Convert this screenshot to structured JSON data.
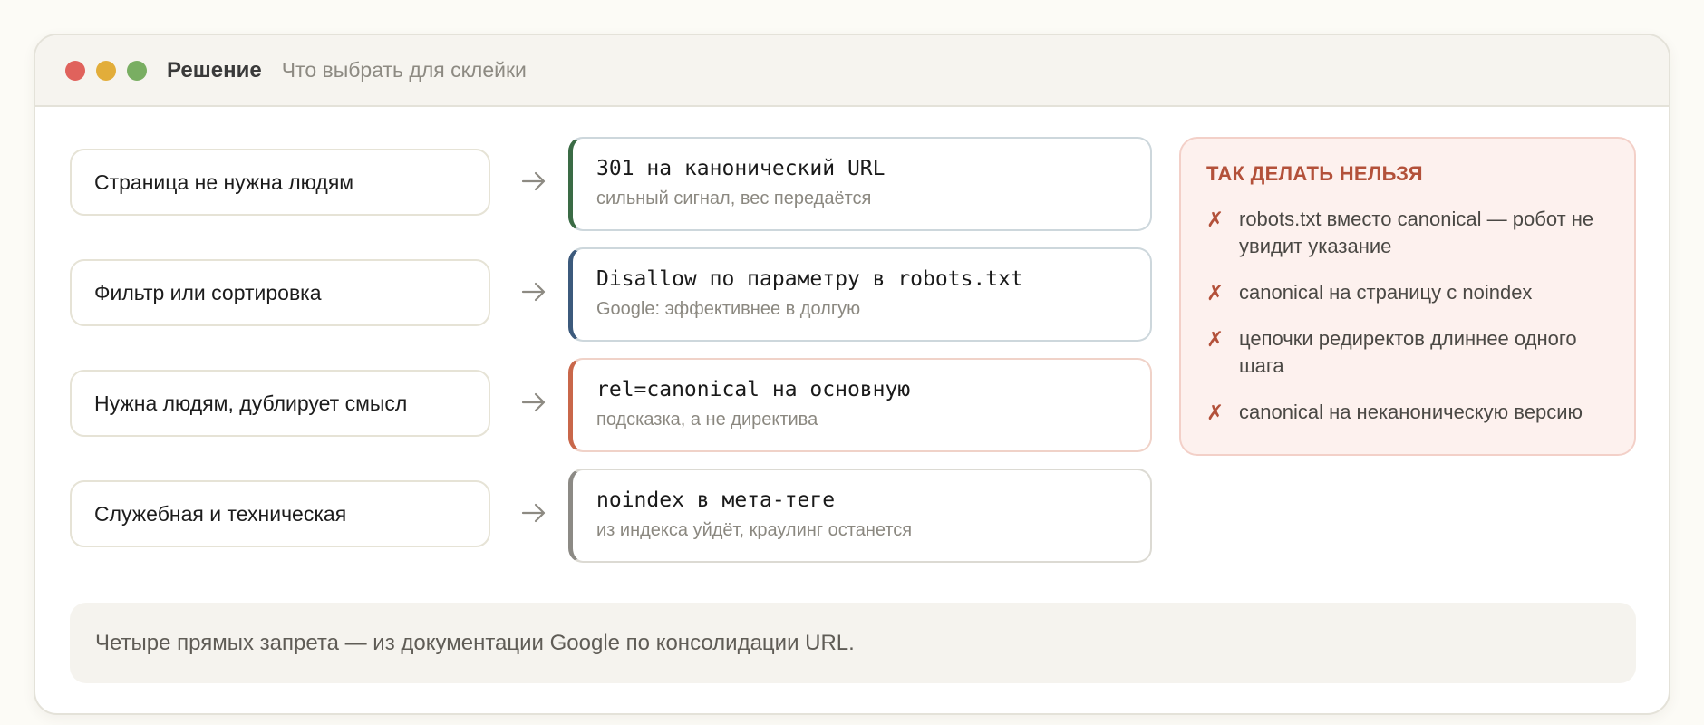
{
  "window": {
    "title": "Решение",
    "subtitle": "Что выбрать для склейки"
  },
  "rows": [
    {
      "condition": "Страница не нужна людям",
      "action": "301 на канонический URL",
      "note": "сильный сигнал, вес передаётся",
      "accent": "#3a6b45"
    },
    {
      "condition": "Фильтр или сортировка",
      "action": "Disallow по параметру в robots.txt",
      "note": "Google: эффективнее в долгую",
      "accent": "#3c5a7c"
    },
    {
      "condition": "Нужна людям, дублирует смысл",
      "action": "rel=canonical на основную",
      "note": "подсказка, а не директива",
      "accent": "#c9674a"
    },
    {
      "condition": "Служебная и техническая",
      "action": "noindex в мета-теге",
      "note": "из индекса уйдёт, краулинг останется",
      "accent": "#8c8a85"
    }
  ],
  "donts": {
    "title": "ТАК ДЕЛАТЬ НЕЛЬЗЯ",
    "mark": "✗",
    "items": [
      "robots.txt вместо canonical — робот не увидит указание",
      "canonical на страницу с noindex",
      "цепочки редиректов длиннее одного шага",
      "canonical на неканоническую версию"
    ]
  },
  "footnote": "Четыре прямых запрета — из документации Google по консолидации URL.",
  "colors": {
    "dot_red": "#e0625c",
    "dot_yellow": "#e2ad3a",
    "dot_green": "#79ae62",
    "warning": "#b3513a"
  }
}
